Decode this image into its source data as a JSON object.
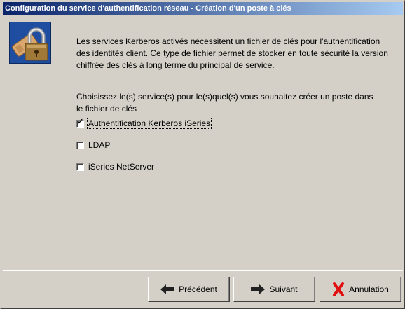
{
  "window": {
    "title": "Configuration du service d'authentification réseau - Création d'un poste à clés"
  },
  "header_icon": "keyring-lock-icon",
  "description": "Les services Kerberos activés nécessitent un fichier de clés pour l'authentification des identités client. Ce type de fichier permet de stocker en toute sécurité la version chiffrée des clés à long terme du principal de service.",
  "prompt": "Choisissez le(s) service(s) pour le(s)quel(s) vous souhaitez créer un poste dans le fichier de clés",
  "services": [
    {
      "label": "Authentification Kerberos iSeries",
      "checked": true
    },
    {
      "label": "LDAP",
      "checked": false
    },
    {
      "label": "iSeries NetServer",
      "checked": false
    }
  ],
  "buttons": {
    "back": {
      "label": "Précédent",
      "icon": "arrow-left-icon"
    },
    "next": {
      "label": "Suivant",
      "icon": "arrow-right-icon"
    },
    "cancel": {
      "label": "Annulation",
      "icon": "red-x-icon"
    }
  },
  "colors": {
    "titlebar_start": "#0a246a",
    "titlebar_end": "#a6caf0",
    "cancel_icon": "#e01010"
  }
}
